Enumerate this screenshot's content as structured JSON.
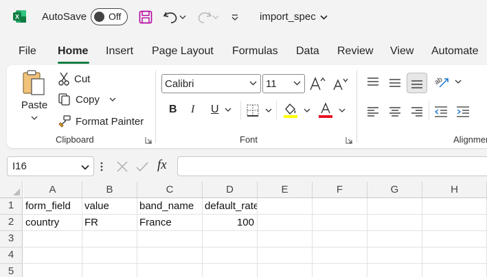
{
  "titlebar": {
    "autosave_label": "AutoSave",
    "toggle_state": "Off",
    "doc_title": "import_spec"
  },
  "tabs": [
    "File",
    "Home",
    "Insert",
    "Page Layout",
    "Formulas",
    "Data",
    "Review",
    "View",
    "Automate"
  ],
  "ribbon": {
    "clipboard": {
      "paste": "Paste",
      "cut": "Cut",
      "copy": "Copy",
      "format_painter": "Format Painter",
      "label": "Clipboard"
    },
    "font": {
      "font_name": "Calibri",
      "font_size": "11",
      "bold": "B",
      "italic": "I",
      "underline": "U",
      "label": "Font"
    },
    "alignment": {
      "label": "Alignment"
    },
    "colors": {
      "highlight": "#ffff00",
      "font_color": "#ff0000",
      "accent": "#107c41"
    }
  },
  "formula_bar": {
    "name_box": "I16",
    "fx": "fx",
    "formula": ""
  },
  "sheet": {
    "columns": [
      "A",
      "B",
      "C",
      "D",
      "E",
      "F",
      "G",
      "H"
    ],
    "rows": [
      "1",
      "2",
      "3",
      "4",
      "5"
    ],
    "cells": [
      [
        "form_field",
        "value",
        "band_name",
        "default_rate",
        "",
        "",
        "",
        ""
      ],
      [
        "country",
        "FR",
        "France",
        "100",
        "",
        "",
        "",
        ""
      ],
      [
        "",
        "",
        "",
        "",
        "",
        "",
        "",
        ""
      ],
      [
        "",
        "",
        "",
        "",
        "",
        "",
        "",
        ""
      ],
      [
        "",
        "",
        "",
        "",
        "",
        "",
        "",
        ""
      ]
    ]
  }
}
